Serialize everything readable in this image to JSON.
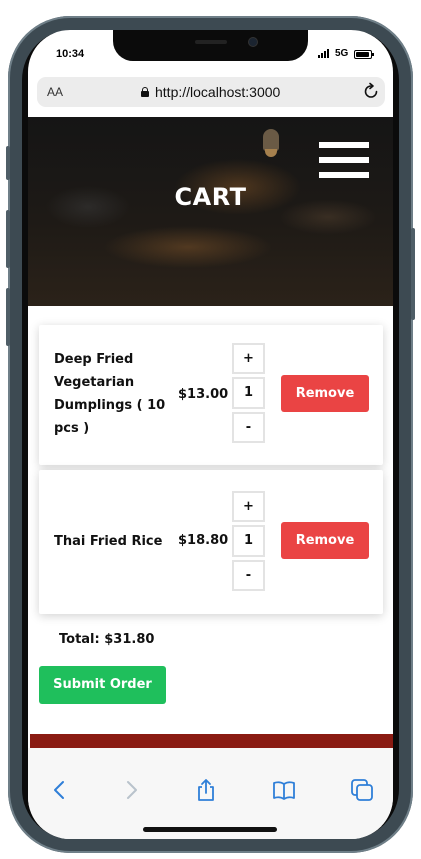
{
  "status_bar": {
    "time": "10:34",
    "network": "5G"
  },
  "browser": {
    "aa_label": "AA",
    "url": "http://localhost:3000"
  },
  "hero": {
    "title": "CART"
  },
  "cart": {
    "items": [
      {
        "name": "Deep Fried Vegetarian Dumplings ( 10 pcs )",
        "price": "$13.00",
        "quantity": "1",
        "increment_label": "+",
        "decrement_label": "-",
        "remove_label": "Remove"
      },
      {
        "name": "Thai Fried Rice",
        "price": "$18.80",
        "quantity": "1",
        "increment_label": "+",
        "decrement_label": "-",
        "remove_label": "Remove"
      }
    ],
    "total_label": "Total: $31.80",
    "submit_label": "Submit Order"
  },
  "colors": {
    "remove_button": "#ea4444",
    "submit_button": "#1fbf5c",
    "footer_strip": "#8a1b12",
    "safari_accent": "#2f7fd8"
  },
  "toolbar": {
    "icons": [
      "back-icon",
      "forward-icon",
      "share-icon",
      "bookmarks-icon",
      "tabs-icon"
    ]
  }
}
